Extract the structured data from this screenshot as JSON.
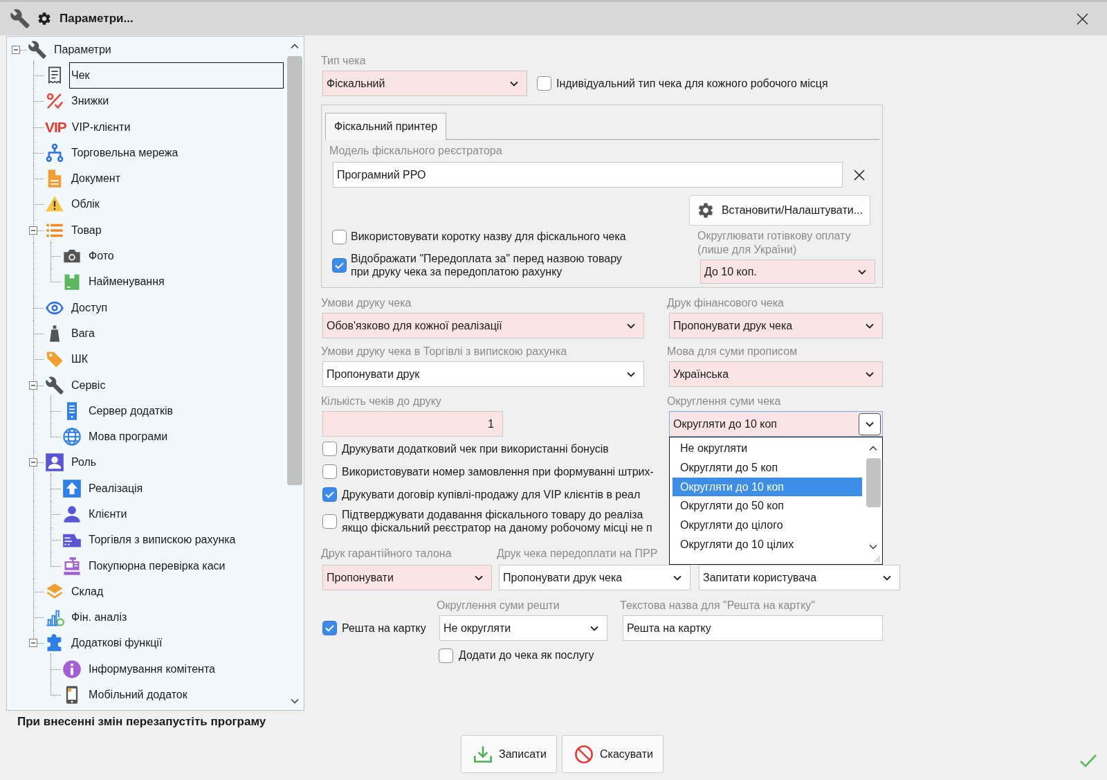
{
  "window": {
    "title": "Параметри..."
  },
  "tree": {
    "items": [
      {
        "label": "Параметри",
        "selected": false,
        "expanded": true,
        "children": [
          {
            "label": "Чек",
            "selected": true
          },
          {
            "label": "Знижки",
            "selected": false
          },
          {
            "label": "VIP-клієнти",
            "selected": false,
            "logo": "VIP"
          },
          {
            "label": "Торговельна мережа",
            "selected": false
          },
          {
            "label": "Документ",
            "selected": false
          },
          {
            "label": "Облік",
            "selected": false
          },
          {
            "label": "Товар",
            "selected": false,
            "expanded": true,
            "children": [
              {
                "label": "Фото",
                "selected": false
              },
              {
                "label": "Найменування",
                "selected": false
              }
            ]
          },
          {
            "label": "Доступ",
            "selected": false
          },
          {
            "label": "Вага",
            "selected": false
          },
          {
            "label": "ШК",
            "selected": false
          },
          {
            "label": "Сервіс",
            "selected": false,
            "expanded": true,
            "children": [
              {
                "label": "Сервер додатків",
                "selected": false
              },
              {
                "label": "Мова програми",
                "selected": false
              }
            ]
          },
          {
            "label": "Роль",
            "selected": false,
            "expanded": true,
            "children": [
              {
                "label": "Реалізація",
                "selected": false
              },
              {
                "label": "Клієнти",
                "selected": false
              },
              {
                "label": "Торгівля з випискою рахунка",
                "selected": false
              },
              {
                "label": "Покупюрна перевірка каси",
                "selected": false
              }
            ]
          },
          {
            "label": "Склад",
            "selected": false
          },
          {
            "label": "Фін. аналіз",
            "selected": false
          },
          {
            "label": "Додаткові функції",
            "selected": false,
            "expanded": true,
            "children": [
              {
                "label": "Інформування комітента",
                "selected": false
              },
              {
                "label": "Мобільний додаток",
                "selected": false
              }
            ]
          }
        ]
      }
    ]
  },
  "restart_note": "При внесенні змін перезапустіть програму",
  "form": {
    "receipt_type": {
      "label": "Тип чека",
      "value": "Фіскальний",
      "highlighted": true
    },
    "per_workplace": {
      "label": "Індивідуальний тип чека для кожного робочого місця",
      "checked": false
    },
    "printer_group": {
      "tabs": [
        {
          "label": "Фіскальний принтер",
          "selected": true
        }
      ],
      "model": {
        "label": "Модель фіскального реєстратора",
        "value": "Програмний РРО"
      },
      "setup_button": "Встановити/Налаштувати...",
      "options": [
        {
          "label": "Використовувати коротку назву для фіскального чека",
          "checked": false
        },
        {
          "label": "Відображати \"Передоплата за\" перед назвою товару\nпри друку чека за передоплатою рахунку",
          "checked": true
        }
      ],
      "cash_rounding": {
        "label": "Округлювати готівкову оплату\n(лише для України)",
        "value": "До 10 коп.",
        "highlighted": true
      }
    },
    "print_conditions": {
      "label": "Умови друку чека",
      "value": "Обов'язково для кожної реалізації",
      "highlighted": true
    },
    "financial_receipt": {
      "label": "Друк фінансового чека",
      "value": "Пропонувати друк чека",
      "highlighted": true
    },
    "invoice_print_conditions": {
      "label": "Умови друку чека в Торгівлі з випискою рахунка",
      "value": "Пропонувати друк",
      "highlighted": false
    },
    "amount_language": {
      "label": "Мова для суми прописом",
      "value": "Українська",
      "highlighted": true
    },
    "receipt_count": {
      "label": "Кількість чеків до друку",
      "value": "1",
      "highlighted": true
    },
    "receipt_rounding": {
      "label": "Округлення суми чека",
      "value": "Округляти до 10 коп",
      "highlighted": true,
      "expanded": true,
      "options": [
        {
          "label": "Не округляти",
          "selected": false
        },
        {
          "label": "Округляти до 5 коп",
          "selected": false
        },
        {
          "label": "Округляти до 10 коп",
          "selected": true
        },
        {
          "label": "Округляти до 50 коп",
          "selected": false
        },
        {
          "label": "Округляти до цілого",
          "selected": false
        },
        {
          "label": "Округляти до 10 цілих",
          "selected": false
        }
      ]
    },
    "print_options": [
      {
        "label": "Друкувати додатковий чек при використанні бонусів",
        "checked": false
      },
      {
        "label": "Використовувати номер замовлення при формуванні штрих-",
        "checked": false
      },
      {
        "label": "Друкувати договір купівлі-продажу для VIP клієнтів в реал",
        "checked": true
      },
      {
        "label": "Підтверджувати додавання фіскального товару до реаліза\nякщо фіскальний реєстратор на даному робочому місці не п",
        "checked": false
      }
    ],
    "warranty_print": {
      "label": "Друк гарантійного талона",
      "value": "Пропонувати",
      "highlighted": true
    },
    "prepayment_print": {
      "label": "Друк чека передоплати на ПРР",
      "value": "Пропонувати друк чека",
      "highlighted": false
    },
    "unlabeled_dropdown": {
      "value": "Запитати користувача",
      "highlighted": false
    },
    "change_to_card": {
      "label": "Решта на картку",
      "checked": true
    },
    "change_rounding": {
      "label": "Округлення суми решти",
      "value": "Не округляти",
      "highlighted": false
    },
    "change_text": {
      "label": "Текстова назва для \"Решта на картку\"",
      "value": "Решта на картку"
    },
    "add_as_service": {
      "label": "Додати до чека як послугу",
      "checked": false
    }
  },
  "buttons": [
    {
      "label": "Записати",
      "kind": "save"
    },
    {
      "label": "Скасувати",
      "kind": "cancel"
    }
  ]
}
